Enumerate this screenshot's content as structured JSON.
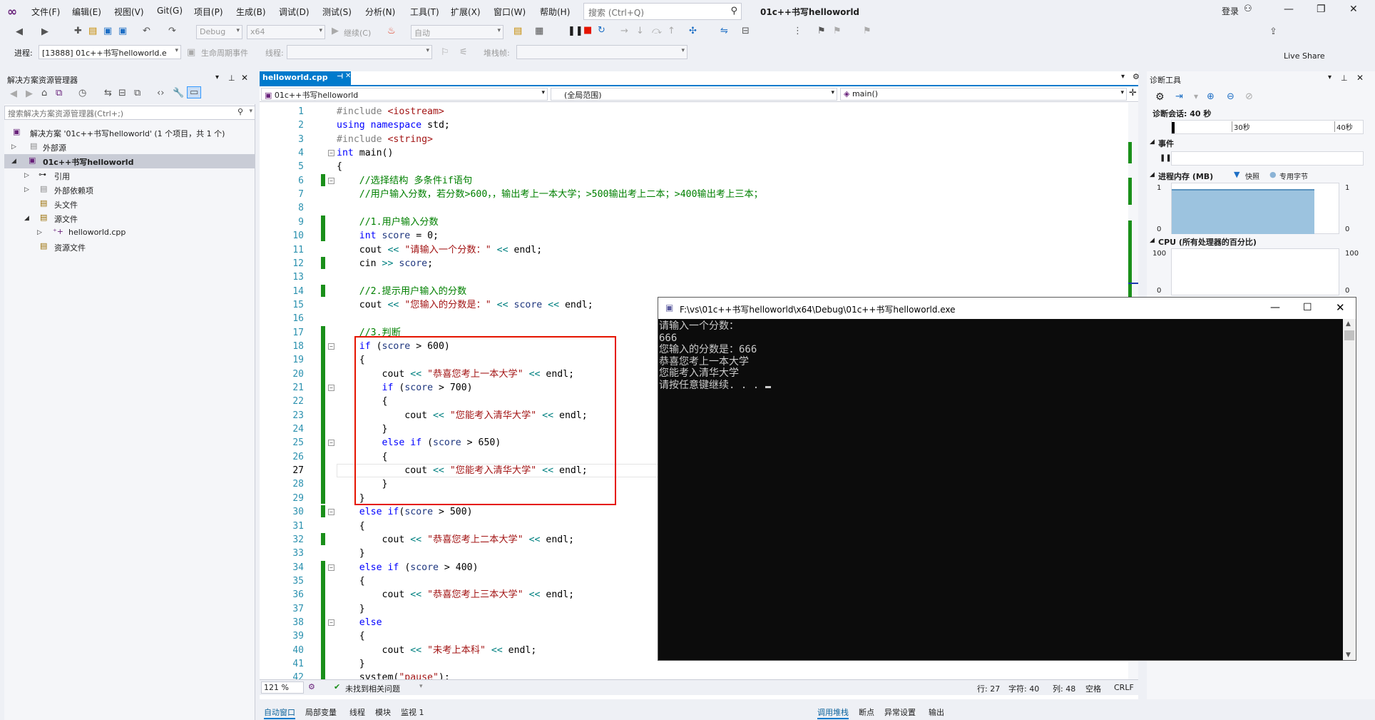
{
  "menubar": {
    "items": [
      "文件(F)",
      "编辑(E)",
      "视图(V)",
      "Git(G)",
      "项目(P)",
      "生成(B)",
      "调试(D)",
      "测试(S)",
      "分析(N)",
      "工具(T)",
      "扩展(X)",
      "窗口(W)",
      "帮助(H)"
    ],
    "search_placeholder": "搜索 (Ctrl+Q)",
    "window_title": "01c++书写helloworld",
    "login": "登录"
  },
  "toolbar": {
    "config": "Debug",
    "platform": "x64",
    "continue": "继续(C)",
    "auto": "自动",
    "live_share": "Live Share",
    "process_label": "进程:",
    "process_value": "[13888] 01c++书写helloworld.e",
    "lifecycle": "生命周期事件",
    "thread": "线程:",
    "stackframe": "堆栈帧:"
  },
  "solution_explorer": {
    "title": "解决方案资源管理器",
    "search_placeholder": "搜索解决方案资源管理器(Ctrl+;)",
    "items": [
      {
        "label": "解决方案 '01c++书写helloworld' (1 个项目，共 1 个)"
      },
      {
        "label": "外部源"
      },
      {
        "label": "01c++书写helloworld"
      },
      {
        "label": "引用"
      },
      {
        "label": "外部依赖项"
      },
      {
        "label": "头文件"
      },
      {
        "label": "源文件"
      },
      {
        "label": "helloworld.cpp"
      },
      {
        "label": "资源文件"
      }
    ]
  },
  "editor": {
    "tab": "helloworld.cpp",
    "nav_project": "01c++书写helloworld",
    "nav_scope": "(全局范围)",
    "nav_member": "main()",
    "zoom": "121 %",
    "status_msg": "未找到相关问题",
    "row": "行: 27",
    "char": "字符: 40",
    "col": "列: 48",
    "space": "空格",
    "eol": "CRLF"
  },
  "code_lines": [
    {
      "n": "1",
      "t": "#include <iostream>"
    },
    {
      "n": "2",
      "t": "using namespace std;"
    },
    {
      "n": "3",
      "t": "#include <string>"
    },
    {
      "n": "4",
      "t": "int main()"
    },
    {
      "n": "5",
      "t": "{"
    },
    {
      "n": "6",
      "t": "    //选择结构 多条件if语句"
    },
    {
      "n": "7",
      "t": "    //用户输入分数，若分数>600，，输出考上一本大学；>500输出考上二本；>400输出考上三本；"
    },
    {
      "n": "8",
      "t": ""
    },
    {
      "n": "9",
      "t": "    //1.用户输入分数"
    },
    {
      "n": "10",
      "t": "    int score = 0;"
    },
    {
      "n": "11",
      "t": "    cout << \"请输入一个分数：\" << endl;"
    },
    {
      "n": "12",
      "t": "    cin >> score;"
    },
    {
      "n": "13",
      "t": ""
    },
    {
      "n": "14",
      "t": "    //2.提示用户输入的分数"
    },
    {
      "n": "15",
      "t": "    cout << \"您输入的分数是：\" << score << endl;"
    },
    {
      "n": "16",
      "t": ""
    },
    {
      "n": "17",
      "t": "    //3.判断"
    },
    {
      "n": "18",
      "t": "    if (score > 600)"
    },
    {
      "n": "19",
      "t": "    {"
    },
    {
      "n": "20",
      "t": "        cout << \"恭喜您考上一本大学\" << endl;"
    },
    {
      "n": "21",
      "t": "        if (score > 700)"
    },
    {
      "n": "22",
      "t": "        {"
    },
    {
      "n": "23",
      "t": "            cout << \"您能考入清华大学\" << endl;"
    },
    {
      "n": "24",
      "t": "        }"
    },
    {
      "n": "25",
      "t": "        else if (score > 650)"
    },
    {
      "n": "26",
      "t": "        {"
    },
    {
      "n": "27",
      "t": "            cout << \"您能考入清华大学\" << endl;"
    },
    {
      "n": "28",
      "t": "        }"
    },
    {
      "n": "29",
      "t": "    }"
    },
    {
      "n": "30",
      "t": "    else if(score > 500)"
    },
    {
      "n": "31",
      "t": "    {"
    },
    {
      "n": "32",
      "t": "        cout << \"恭喜您考上二本大学\" << endl;"
    },
    {
      "n": "33",
      "t": "    }"
    },
    {
      "n": "34",
      "t": "    else if (score > 400)"
    },
    {
      "n": "35",
      "t": "    {"
    },
    {
      "n": "36",
      "t": "        cout << \"恭喜您考上三本大学\" << endl;"
    },
    {
      "n": "37",
      "t": "    }"
    },
    {
      "n": "38",
      "t": "    else"
    },
    {
      "n": "39",
      "t": "    {"
    },
    {
      "n": "40",
      "t": "        cout << \"未考上本科\" << endl;"
    },
    {
      "n": "41",
      "t": "    }"
    },
    {
      "n": "42",
      "t": "    system(\"pause\");"
    }
  ],
  "diagnostics": {
    "title": "诊断工具",
    "session": "诊断会话: 40 秒",
    "t30": "30秒",
    "t40": "40秒",
    "events": "事件",
    "memory": "进程内存 (MB)",
    "snapshot": "快照",
    "private": "专用字节",
    "mem_max": "1",
    "mem_min": "0",
    "cpu": "CPU (所有处理器的百分比)",
    "cpu_max": "100",
    "cpu_min": "0"
  },
  "console": {
    "title": "F:\\vs\\01c++书写helloworld\\x64\\Debug\\01c++书写helloworld.exe",
    "lines": [
      "请输入一个分数：",
      "666",
      "您输入的分数是：666",
      "恭喜您考上一本大学",
      "您能考入清华大学",
      "请按任意键继续. . . "
    ]
  },
  "bottom_tabs": {
    "left": [
      "自动窗口",
      "局部变量",
      "线程",
      "模块",
      "监视 1"
    ],
    "right": [
      "调用堆栈",
      "断点",
      "异常设置",
      "输出"
    ]
  }
}
